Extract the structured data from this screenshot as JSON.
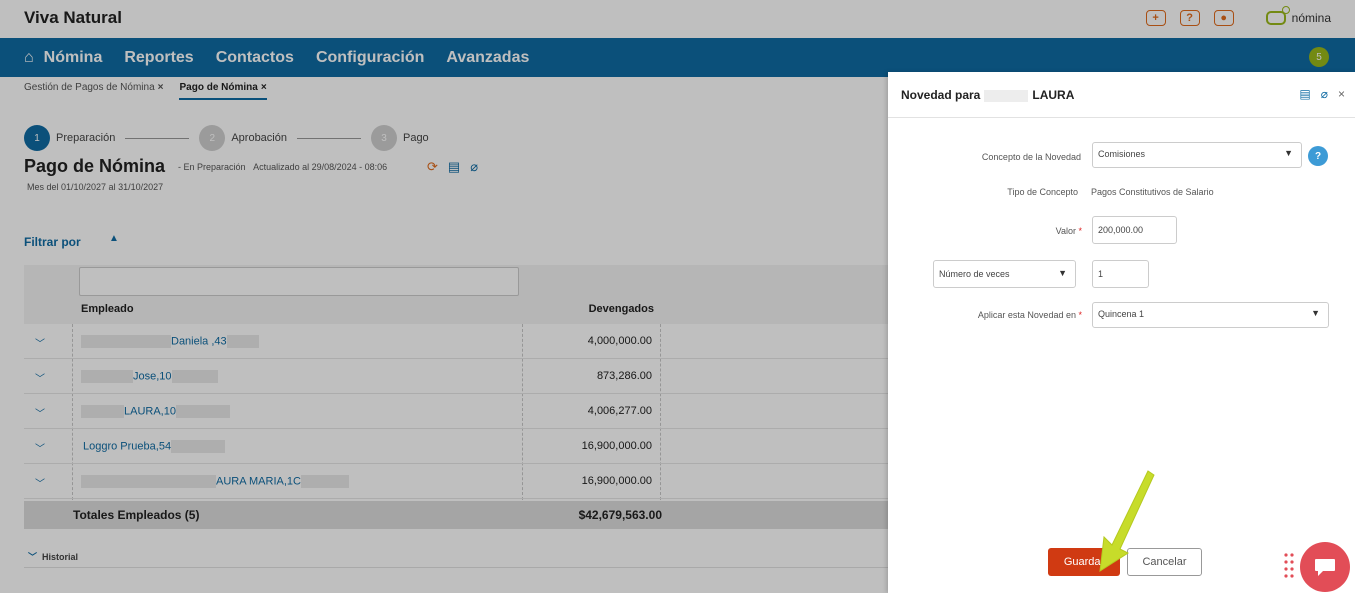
{
  "app": {
    "title": "Viva Natural",
    "logo_text": "nómina",
    "notification_count": "5"
  },
  "top_icons": [
    "plus-icon",
    "help-icon",
    "user-icon"
  ],
  "nav": {
    "items": [
      "Nómina",
      "Reportes",
      "Contactos",
      "Configuración",
      "Avanzadas"
    ]
  },
  "tabs": [
    {
      "label": "Gestión de Pagos de Nómina",
      "close": "×"
    },
    {
      "label": "Pago de Nómina",
      "close": "×"
    }
  ],
  "steps": [
    {
      "number": "1",
      "label": "Preparación"
    },
    {
      "number": "2",
      "label": "Aprobación"
    },
    {
      "number": "3",
      "label": "Pago"
    }
  ],
  "page": {
    "title": "Pago de Nómina",
    "status": "- En Preparación",
    "updated": "Actualizado al 29/08/2024 - 08:06",
    "period": "Mes del 01/10/2027 al 31/10/2027",
    "filter_label": "Filtrar por"
  },
  "table": {
    "headers": {
      "employee": "Empleado",
      "devengados": "Devengados"
    },
    "rows": [
      {
        "name": "Daniela ,43",
        "amount": "4,000,000.00"
      },
      {
        "name": "Jose,10",
        "amount": "873,286.00"
      },
      {
        "name": "LAURA,10",
        "amount": "4,006,277.00"
      },
      {
        "name": "Loggro Prueba,54",
        "amount": "16,900,000.00"
      },
      {
        "name": "AURA MARIA,1C",
        "amount": "16,900,000.00"
      }
    ],
    "totals_label": "Totales Empleados (5)",
    "totals_value": "$42,679,563.00"
  },
  "historial": {
    "label": "Historial"
  },
  "panel": {
    "title_prefix": "Novedad para",
    "title_name": "LAURA",
    "concepto_label": "Concepto de la Novedad",
    "concepto_value": "Comisiones",
    "tipo_label": "Tipo de Concepto",
    "tipo_value": "Pagos Constitutivos de Salario",
    "valor_label": "Valor",
    "valor_value": "200,000.00",
    "veces_select": "Número de veces",
    "veces_value": "1",
    "aplicar_label": "Aplicar esta Novedad en",
    "aplicar_value": "Quincena 1",
    "save_label": "Guardar",
    "cancel_label": "Cancelar",
    "required_mark": "*"
  },
  "colors": {
    "primary": "#0f6ba3",
    "accent_orange": "#e06a1b",
    "brand_green": "#9ab81a",
    "save": "#d03a12",
    "chat": "#e24d57"
  }
}
